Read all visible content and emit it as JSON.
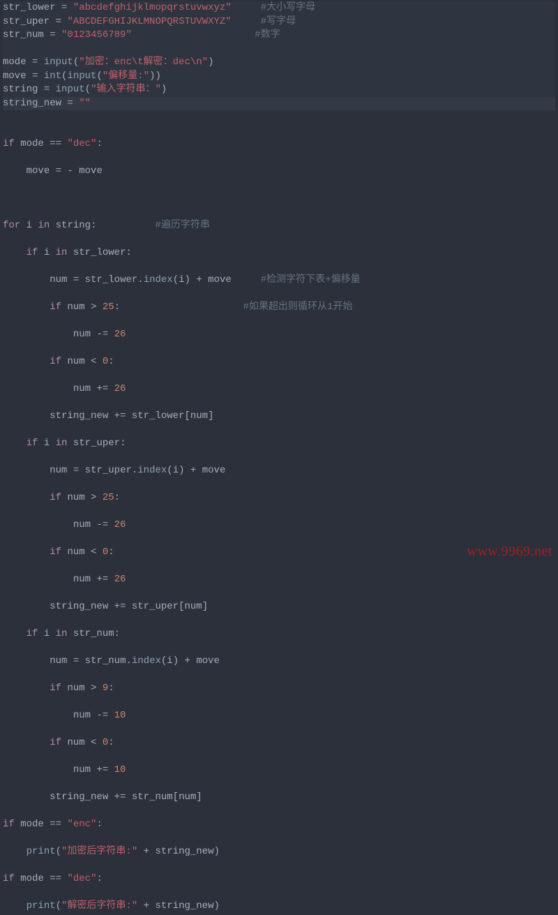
{
  "lines": {
    "l1": {
      "var": "str_lower",
      "eq": " = ",
      "str": "\"abcdefghijklmopqrstuvwxyz\"",
      "pad": "     ",
      "cm": "#大小写字母"
    },
    "l2": {
      "var": "str_uper",
      "eq": " = ",
      "str": "\"ABCDEFGHIJKLMNOPQRSTUVWXYZ\"",
      "pad": "     ",
      "cm": "#写字母"
    },
    "l3": {
      "var": "str_num",
      "eq": " = ",
      "str": "\"0123456789\"",
      "pad": "                     ",
      "cm": "#数字"
    },
    "l5": {
      "var": "mode",
      "eq": " = ",
      "fn": "input",
      "op": "(",
      "arg": "\"加密：enc\\t解密：dec\\n\"",
      "cp": ")"
    },
    "l6": {
      "var": "move",
      "eq": " = ",
      "fn": "int",
      "op": "(",
      "fn2": "input",
      "op2": "(",
      "arg": "\"偏移量:\"",
      "cp": "))"
    },
    "l7": {
      "var": "string",
      "eq": " = ",
      "fn": "input",
      "op": "(",
      "arg": "\"输入字符串：\"",
      "cp": ")"
    },
    "l8": {
      "var": "string_new",
      "eq": " = ",
      "str": "\"\""
    },
    "l10": {
      "kw": "if",
      "sp": " ",
      "var": "mode",
      "eq": " == ",
      "str": "\"dec\"",
      "colon": ":"
    },
    "l11": {
      "pad": "    ",
      "var": "move",
      "eq": " = - ",
      "var2": "move"
    },
    "l13": {
      "kw": "for",
      "sp": " ",
      "var": "i",
      "sp2": " ",
      "kw2": "in",
      "sp3": " ",
      "var2": "string",
      "colon": ":",
      "pad": "          ",
      "cm": "#遍历字符串"
    },
    "l14": {
      "pad": "    ",
      "kw": "if",
      "sp": " ",
      "var": "i",
      "sp2": " ",
      "kw2": "in",
      "sp3": " ",
      "var2": "str_lower",
      "colon": ":"
    },
    "l15": {
      "pad": "        ",
      "var": "num",
      "eq": " = ",
      "var2": "str_lower",
      "dot": ".",
      "fn": "index",
      "op": "(",
      "arg": "i",
      "cp": ")",
      "plus": " + ",
      "var3": "move",
      "pad2": "     ",
      "cm": "#检测字符下表+偏移量"
    },
    "l16": {
      "pad": "        ",
      "kw": "if",
      "sp": " ",
      "var": "num",
      "gt": " > ",
      "num": "25",
      "colon": ":",
      "pad2": "                     ",
      "cm": "#如果超出则循环从1开始"
    },
    "l17": {
      "pad": "            ",
      "var": "num",
      "eq": " -= ",
      "num": "26"
    },
    "l18": {
      "pad": "        ",
      "kw": "if",
      "sp": " ",
      "var": "num",
      "lt": " < ",
      "num": "0",
      "colon": ":"
    },
    "l19": {
      "pad": "            ",
      "var": "num",
      "eq": " += ",
      "num": "26"
    },
    "l20": {
      "pad": "        ",
      "var": "string_new",
      "eq": " += ",
      "var2": "str_lower",
      "br": "[",
      "arg": "num",
      "br2": "]"
    },
    "l21": {
      "pad": "    ",
      "kw": "if",
      "sp": " ",
      "var": "i",
      "sp2": " ",
      "kw2": "in",
      "sp3": " ",
      "var2": "str_uper",
      "colon": ":"
    },
    "l22": {
      "pad": "        ",
      "var": "num",
      "eq": " = ",
      "var2": "str_uper",
      "dot": ".",
      "fn": "index",
      "op": "(",
      "arg": "i",
      "cp": ")",
      "plus": " + ",
      "var3": "move"
    },
    "l23": {
      "pad": "        ",
      "kw": "if",
      "sp": " ",
      "var": "num",
      "gt": " > ",
      "num": "25",
      "colon": ":"
    },
    "l24": {
      "pad": "            ",
      "var": "num",
      "eq": " -= ",
      "num": "26"
    },
    "l25": {
      "pad": "        ",
      "kw": "if",
      "sp": " ",
      "var": "num",
      "lt": " < ",
      "num": "0",
      "colon": ":"
    },
    "l26": {
      "pad": "            ",
      "var": "num",
      "eq": " += ",
      "num": "26"
    },
    "l27": {
      "pad": "        ",
      "var": "string_new",
      "eq": " += ",
      "var2": "str_uper",
      "br": "[",
      "arg": "num",
      "br2": "]"
    },
    "l28": {
      "pad": "    ",
      "kw": "if",
      "sp": " ",
      "var": "i",
      "sp2": " ",
      "kw2": "in",
      "sp3": " ",
      "var2": "str_num",
      "colon": ":"
    },
    "l29": {
      "pad": "        ",
      "var": "num",
      "eq": " = ",
      "var2": "str_num",
      "dot": ".",
      "fn": "index",
      "op": "(",
      "arg": "i",
      "cp": ")",
      "plus": " + ",
      "var3": "move"
    },
    "l30": {
      "pad": "        ",
      "kw": "if",
      "sp": " ",
      "var": "num",
      "gt": " > ",
      "num": "9",
      "colon": ":"
    },
    "l31": {
      "pad": "            ",
      "var": "num",
      "eq": " -= ",
      "num": "10"
    },
    "l32": {
      "pad": "        ",
      "kw": "if",
      "sp": " ",
      "var": "num",
      "lt": " < ",
      "num": "0",
      "colon": ":"
    },
    "l33": {
      "pad": "            ",
      "var": "num",
      "eq": " += ",
      "num": "10"
    },
    "l34": {
      "pad": "        ",
      "var": "string_new",
      "eq": " += ",
      "var2": "str_num",
      "br": "[",
      "arg": "num",
      "br2": "]"
    },
    "l35": {
      "kw": "if",
      "sp": " ",
      "var": "mode",
      "eq": " == ",
      "str": "\"enc\"",
      "colon": ":"
    },
    "l36": {
      "pad": "    ",
      "fn": "print",
      "op": "(",
      "str": "\"加密后字符串:\"",
      "plus": " + ",
      "var": "string_new",
      "cp": ")"
    },
    "l37": {
      "kw": "if",
      "sp": " ",
      "var": "mode",
      "eq": " == ",
      "str": "\"dec\"",
      "colon": ":"
    },
    "l38": {
      "pad": "    ",
      "fn": "print",
      "op": "(",
      "str": "\"解密后字符串:\"",
      "plus": " + ",
      "var": "string_new",
      "cp": ")"
    }
  },
  "watermark": "www.9969.net"
}
